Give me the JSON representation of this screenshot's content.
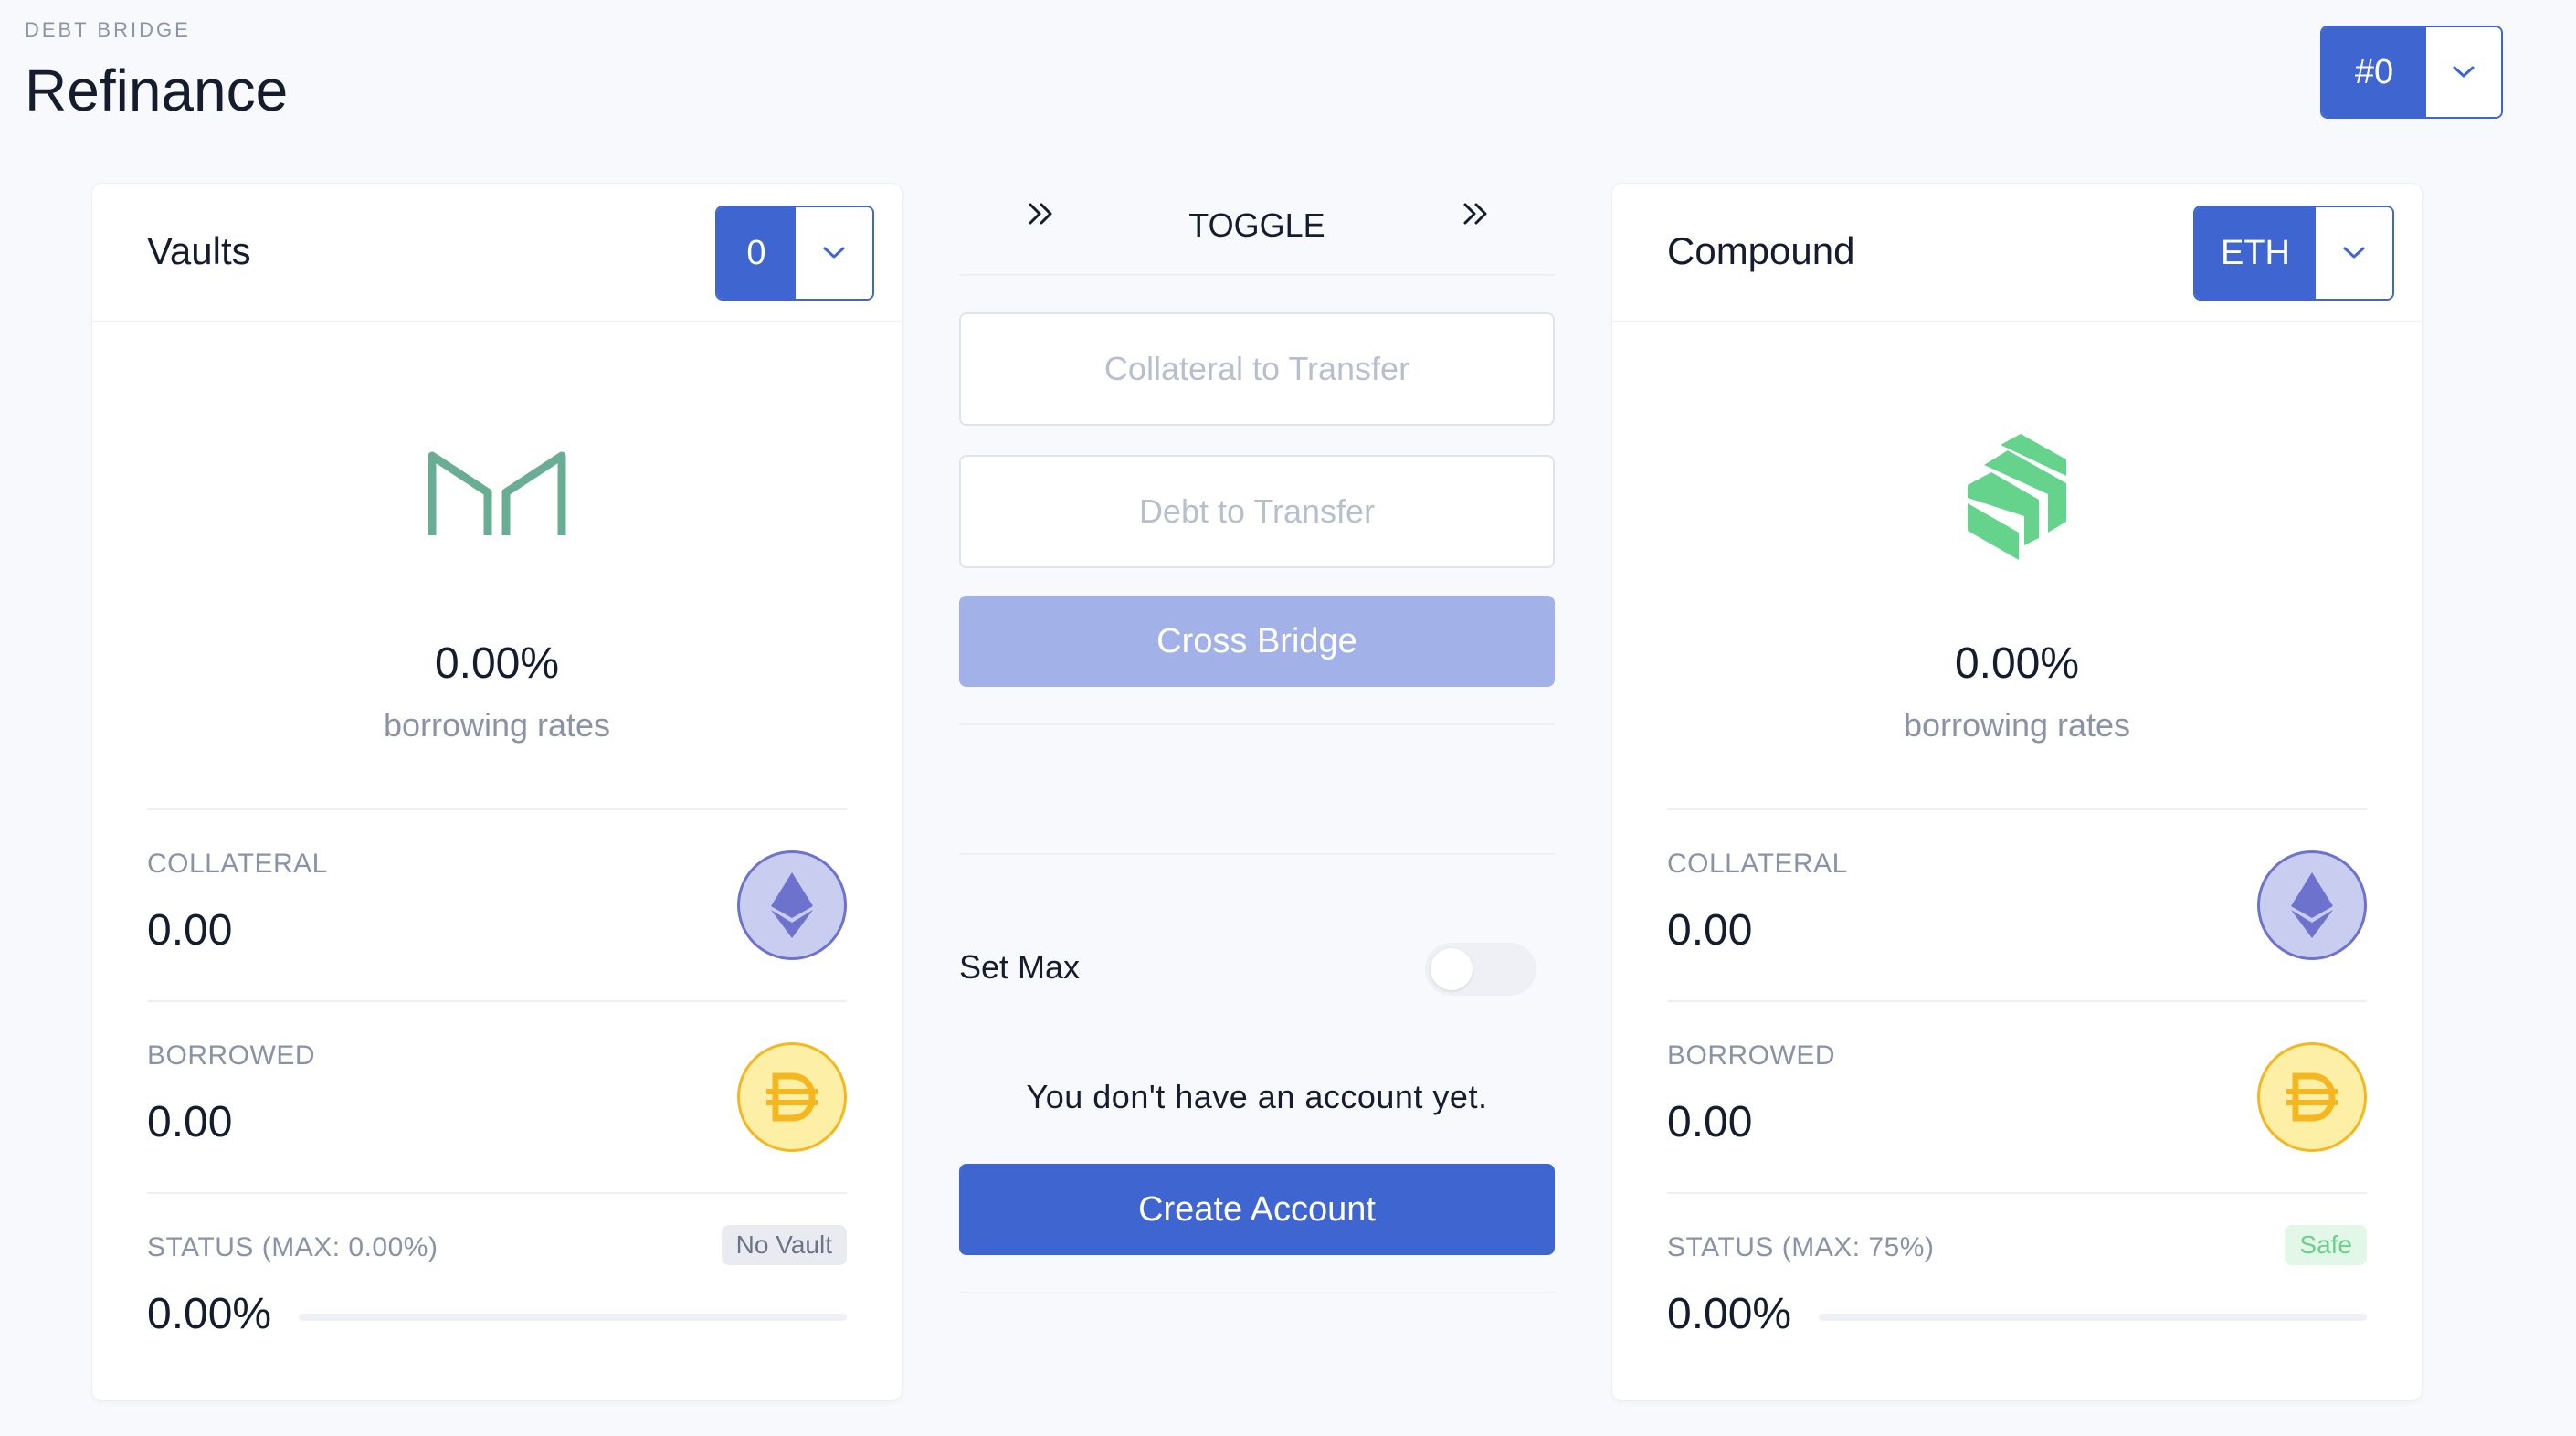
{
  "header": {
    "overline": "DEBT BRIDGE",
    "title": "Refinance",
    "account_select": {
      "value": "#0"
    }
  },
  "left_card": {
    "title": "Vaults",
    "select_value": "0",
    "logo": "maker-logo",
    "rate": "0.00%",
    "rate_label": "borrowing rates",
    "collateral_label": "COLLATERAL",
    "collateral_value": "0.00",
    "collateral_icon": "eth-icon",
    "borrowed_label": "BORROWED",
    "borrowed_value": "0.00",
    "borrowed_icon": "dai-icon",
    "status_label": "STATUS (MAX: 0.00%)",
    "status_badge": "No Vault",
    "status_value": "0.00%",
    "progress": 0
  },
  "center": {
    "toggle_label": "TOGGLE",
    "collateral_placeholder": "Collateral to Transfer",
    "debt_placeholder": "Debt to Transfer",
    "cross_bridge_label": "Cross Bridge",
    "set_max_label": "Set Max",
    "set_max_on": false,
    "no_account_text": "You don't have an account yet.",
    "create_account_label": "Create Account"
  },
  "right_card": {
    "title": "Compound",
    "select_value": "ETH",
    "logo": "compound-logo",
    "rate": "0.00%",
    "rate_label": "borrowing rates",
    "collateral_label": "COLLATERAL",
    "collateral_value": "0.00",
    "collateral_icon": "eth-icon",
    "borrowed_label": "BORROWED",
    "borrowed_value": "0.00",
    "borrowed_icon": "dai-icon",
    "status_label": "STATUS (MAX: 75%)",
    "status_badge": "Safe",
    "status_value": "0.00%",
    "progress": 0
  },
  "colors": {
    "primary": "#3f65d1",
    "primary_disabled": "#a2b2e8",
    "maker_green": "#6aad95",
    "compound_green": "#66d38c",
    "safe_green": "#6bd08a"
  }
}
